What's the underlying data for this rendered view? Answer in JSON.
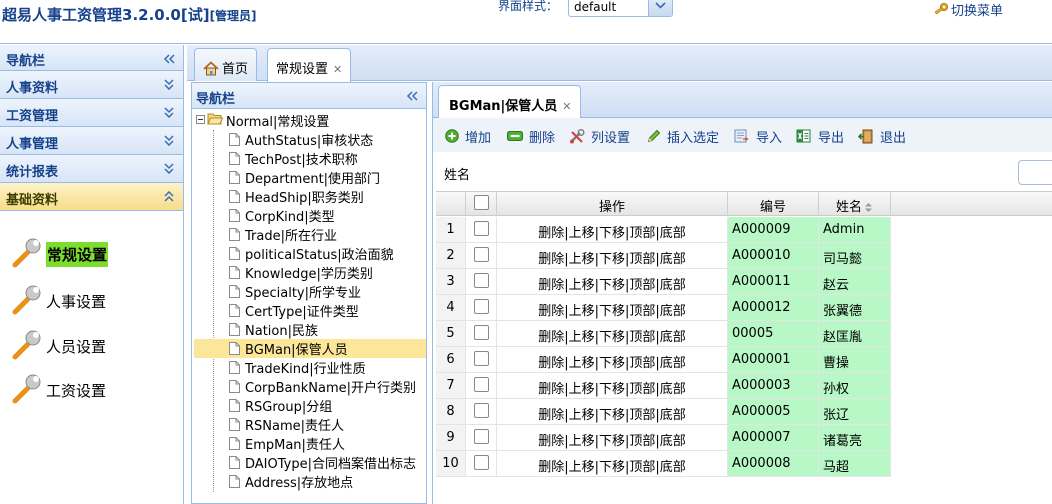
{
  "app": {
    "title": "超易人事工资管理3.2.0.0[试]",
    "role": "[管理员]",
    "theme_label": "界面样式：",
    "theme_value": "default",
    "switch_menu": "切换菜单"
  },
  "leftnav": {
    "title": "导航栏",
    "sections": [
      "人事资料",
      "工资管理",
      "人事管理",
      "统计报表",
      "基础资料"
    ],
    "active_section": "基础资料",
    "features": [
      "常规设置",
      "人事设置",
      "人员设置",
      "工资设置"
    ],
    "selected_feature": "常规设置"
  },
  "main_tabs": [
    {
      "label": "首页",
      "icon": "home-icon"
    },
    {
      "label": "常规设置",
      "closable": true
    }
  ],
  "tree": {
    "title": "导航栏",
    "root": "Normal|常规设置",
    "items": [
      "AuthStatus|审核状态",
      "TechPost|技术职称",
      "Department|使用部门",
      "HeadShip|职务类别",
      "CorpKind|类型",
      "Trade|所在行业",
      "politicalStatus|政治面貌",
      "Knowledge|学历类别",
      "Specialty|所学专业",
      "CertType|证件类型",
      "Nation|民族",
      "BGMan|保管人员",
      "TradeKind|行业性质",
      "CorpBankName|开户行类别",
      "RSGroup|分组",
      "RSName|责任人",
      "EmpMan|责任人",
      "DAIOType|合同档案借出标志",
      "Address|存放地点"
    ],
    "selected": "BGMan|保管人员"
  },
  "content_tab": {
    "label": "BGMan|保管人员",
    "closable": true
  },
  "toolbar": {
    "add": "增加",
    "delete": "删除",
    "columns": "列设置",
    "insert": "插入选定",
    "import": "导入",
    "export": "导出",
    "exit": "退出"
  },
  "filter": {
    "label": "姓名"
  },
  "grid": {
    "headers": {
      "ops": "操作",
      "code": "编号",
      "name": "姓名"
    },
    "ops_text": "删除|上移|下移|顶部|底部",
    "rows": [
      {
        "no": "1",
        "code": "A000009",
        "name": "Admin"
      },
      {
        "no": "2",
        "code": "A000010",
        "name": "司马懿"
      },
      {
        "no": "3",
        "code": "A000011",
        "name": "赵云"
      },
      {
        "no": "4",
        "code": "A000012",
        "name": "张翼德"
      },
      {
        "no": "5",
        "code": "00005",
        "name": "赵匡胤"
      },
      {
        "no": "6",
        "code": "A000001",
        "name": "曹操"
      },
      {
        "no": "7",
        "code": "A000003",
        "name": "孙权"
      },
      {
        "no": "8",
        "code": "A000005",
        "name": "张辽"
      },
      {
        "no": "9",
        "code": "A000007",
        "name": "诸葛亮"
      },
      {
        "no": "10",
        "code": "A000008",
        "name": "马超"
      }
    ],
    "highlight_color": "#b8f8c6"
  },
  "colors": {
    "brand": "#15428b",
    "border": "#99bbe8",
    "selected": "#fbe69a",
    "feature_selected": "#7cdd30"
  }
}
